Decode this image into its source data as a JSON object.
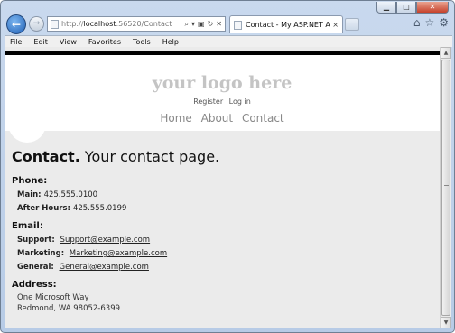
{
  "browser": {
    "url_prefix": "http://",
    "url_host": "localhost",
    "url_rest": ":56520/Contact",
    "tab_title": "Contact - My ASP.NET App...",
    "tab_close": "×",
    "window_close": "✕",
    "window_min": "▁",
    "window_max": "□"
  },
  "menu": [
    "File",
    "Edit",
    "View",
    "Favorites",
    "Tools",
    "Help"
  ],
  "site": {
    "logo": "your logo here",
    "register": "Register",
    "login": "Log in",
    "nav": [
      "Home",
      "About",
      "Contact"
    ]
  },
  "page": {
    "title_bold": "Contact.",
    "title_rest": " Your contact page."
  },
  "phone": {
    "heading": "Phone:",
    "rows": [
      {
        "label": "Main:",
        "value": "425.555.0100"
      },
      {
        "label": "After Hours:",
        "value": "425.555.0199"
      }
    ]
  },
  "email": {
    "heading": "Email:",
    "rows": [
      {
        "label": "Support:",
        "value": "Support@example.com"
      },
      {
        "label": "Marketing:",
        "value": "Marketing@example.com"
      },
      {
        "label": "General:",
        "value": "General@example.com"
      }
    ]
  },
  "address": {
    "heading": "Address:",
    "lines": [
      "One Microsoft Way",
      "Redmond, WA 98052-6399"
    ]
  },
  "icons": {
    "back": "back-arrow-icon",
    "forward": "forward-arrow-icon",
    "search": "search-icon",
    "refresh": "refresh-icon",
    "stop": "stop-icon",
    "home": "home-icon",
    "favorites": "star-icon",
    "tools": "gear-icon"
  }
}
